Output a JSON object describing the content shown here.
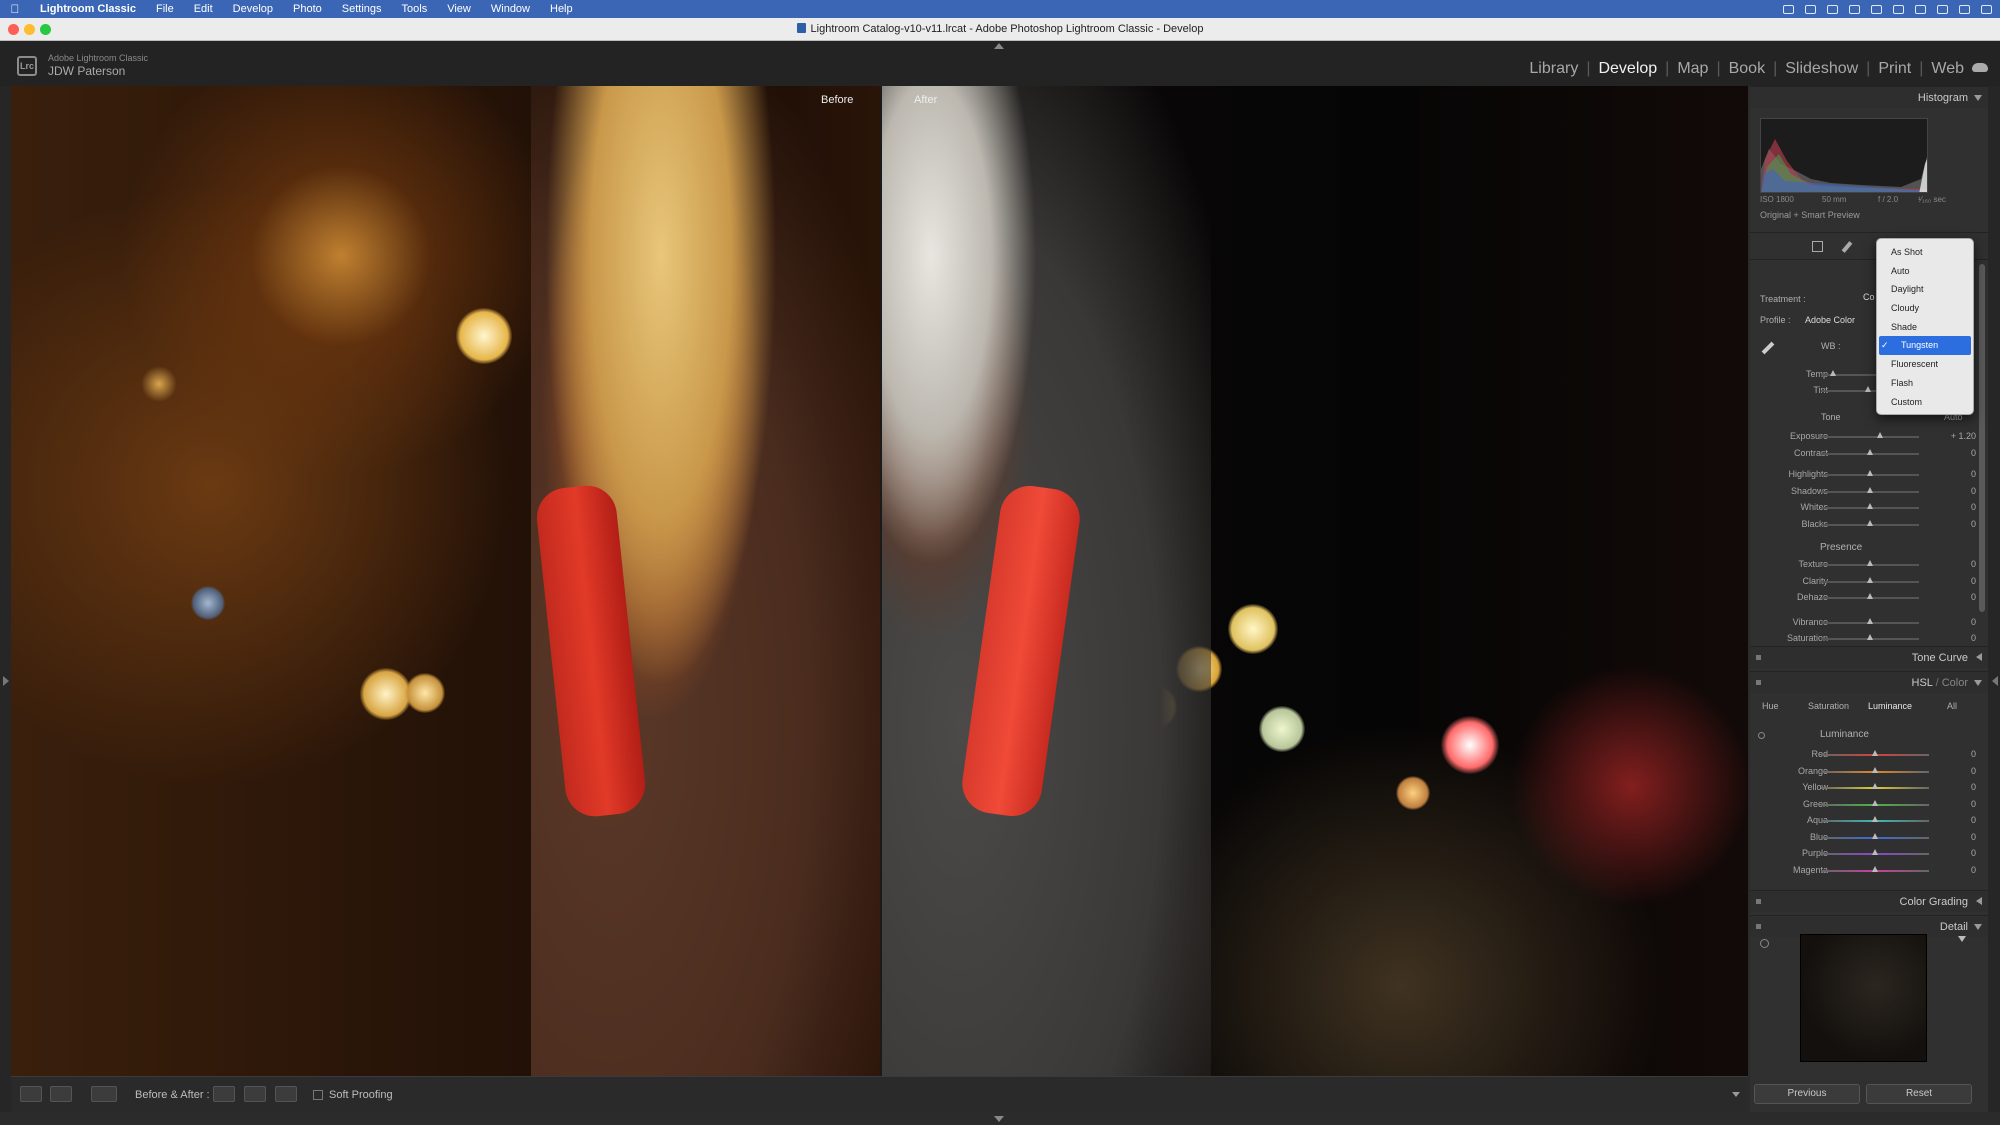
{
  "menubar": {
    "app": "Lightroom Classic",
    "items": [
      "File",
      "Edit",
      "Develop",
      "Photo",
      "Settings",
      "Tools",
      "View",
      "Window",
      "Help"
    ]
  },
  "window": {
    "title": "Lightroom Catalog-v10-v11.lrcat - Adobe Photoshop Lightroom Classic - Develop"
  },
  "identity": {
    "logo": "Lrc",
    "line1": "Adobe Lightroom Classic",
    "line2": "JDW Paterson"
  },
  "modules": [
    "Library",
    "Develop",
    "Map",
    "Book",
    "Slideshow",
    "Print",
    "Web"
  ],
  "active_module": "Develop",
  "viewer": {
    "before_label": "Before",
    "after_label": "After"
  },
  "toolbar": {
    "before_after_label": "Before & After :",
    "soft_proofing_label": "Soft Proofing"
  },
  "panel": {
    "histogram": {
      "title": "Histogram",
      "iso": "ISO 1800",
      "focal": "50 mm",
      "aperture": "f / 2.0",
      "shutter": "¹⁄₁₆₀ sec",
      "preview_label": "Original + Smart Preview"
    },
    "basic": {
      "treatment_label": "Treatment :",
      "treatment_value": "Co",
      "profile_label": "Profile :",
      "profile_value": "Adobe Color",
      "wb_label": "WB :",
      "temp_label": "Temp",
      "tint_label": "Tint",
      "tone_label": "Tone",
      "auto_label": "Auto",
      "presence_label": "Presence",
      "tone_sliders": [
        {
          "label": "Exposure",
          "value": "+ 1.20",
          "pos": 0.6
        },
        {
          "label": "Contrast",
          "value": "0",
          "pos": 0.5
        },
        {
          "label": "Highlights",
          "value": "0",
          "pos": 0.5
        },
        {
          "label": "Shadows",
          "value": "0",
          "pos": 0.5
        },
        {
          "label": "Whites",
          "value": "0",
          "pos": 0.5
        },
        {
          "label": "Blacks",
          "value": "0",
          "pos": 0.5
        }
      ],
      "presence_sliders": [
        {
          "label": "Texture",
          "value": "0",
          "pos": 0.5
        },
        {
          "label": "Clarity",
          "value": "0",
          "pos": 0.5
        },
        {
          "label": "Dehaze",
          "value": "0",
          "pos": 0.5
        },
        {
          "label": "Vibrance",
          "value": "0",
          "pos": 0.5
        },
        {
          "label": "Saturation",
          "value": "0",
          "pos": 0.5
        }
      ]
    },
    "wb_menu": {
      "items": [
        "As Shot",
        "Auto",
        "Daylight",
        "Cloudy",
        "Shade",
        "Tungsten",
        "Fluorescent",
        "Flash",
        "Custom"
      ],
      "selected": "Tungsten"
    },
    "tone_curve_title": "Tone Curve",
    "hsl": {
      "title_hsl": "HSL",
      "title_sep": " / ",
      "title_color": "Color",
      "tabs": [
        "Hue",
        "Saturation",
        "Luminance",
        "All"
      ],
      "active_tab": "Luminance",
      "section_label": "Luminance",
      "sliders": [
        {
          "label": "Red",
          "value": "0",
          "color": "#d0433a"
        },
        {
          "label": "Orange",
          "value": "0",
          "color": "#e0852e"
        },
        {
          "label": "Yellow",
          "value": "0",
          "color": "#d8cc38"
        },
        {
          "label": "Green",
          "value": "0",
          "color": "#4eb24a"
        },
        {
          "label": "Aqua",
          "value": "0",
          "color": "#3cb8b4"
        },
        {
          "label": "Blue",
          "value": "0",
          "color": "#3a6ad8"
        },
        {
          "label": "Purple",
          "value": "0",
          "color": "#8a48c8"
        },
        {
          "label": "Magenta",
          "value": "0",
          "color": "#c8409c"
        }
      ]
    },
    "color_grading_title": "Color Grading",
    "detail_title": "Detail",
    "buttons": {
      "previous": "Previous",
      "reset": "Reset"
    }
  },
  "colors": {
    "menubar": "#3a66b5",
    "selected": "#2c6ee0",
    "panel_bg": "#303030"
  }
}
